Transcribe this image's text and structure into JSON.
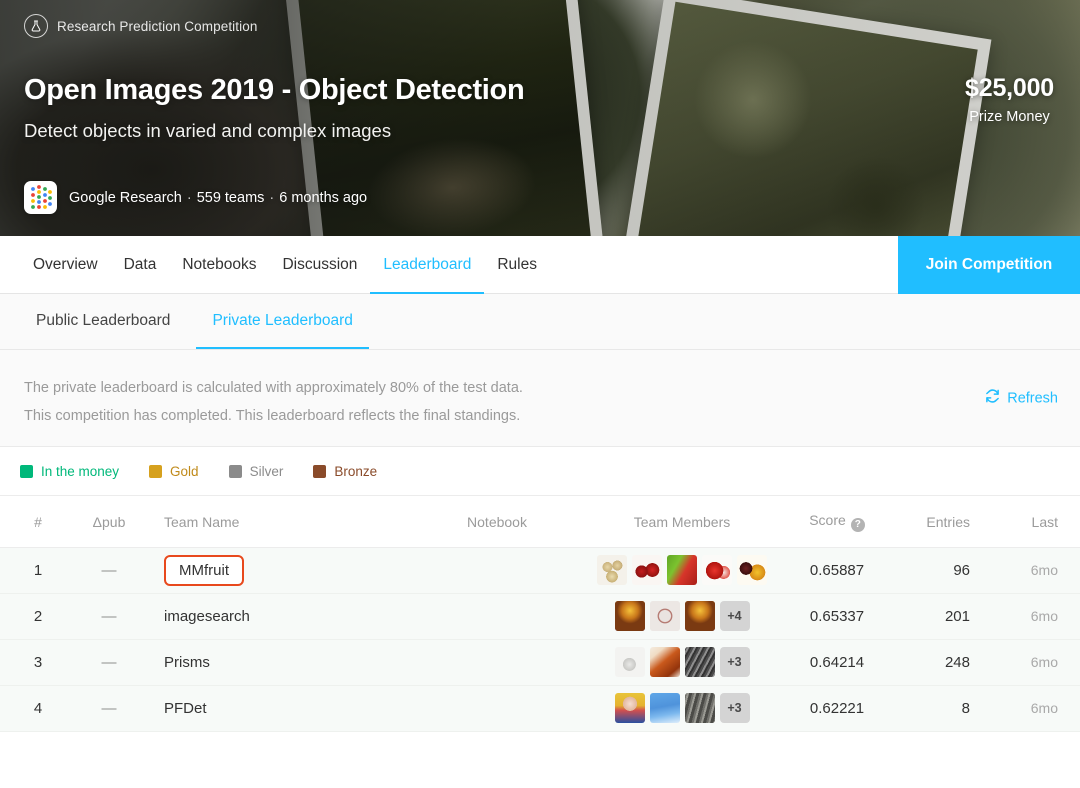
{
  "hero": {
    "badge_label": "Research Prediction Competition",
    "badge_icon": "flask-icon",
    "title": "Open Images 2019 - Object Detection",
    "subtitle": "Detect objects in varied and complex images",
    "prize_amount": "$25,000",
    "prize_label": "Prize Money",
    "org_name": "Google Research",
    "teams": "559 teams",
    "age": "6 months ago",
    "separator": "·"
  },
  "nav": {
    "tabs": [
      {
        "label": "Overview",
        "active": false
      },
      {
        "label": "Data",
        "active": false
      },
      {
        "label": "Notebooks",
        "active": false
      },
      {
        "label": "Discussion",
        "active": false
      },
      {
        "label": "Leaderboard",
        "active": true
      },
      {
        "label": "Rules",
        "active": false
      }
    ],
    "join_label": "Join Competition",
    "accent_color": "#20beff"
  },
  "subtabs": [
    {
      "label": "Public Leaderboard",
      "active": false
    },
    {
      "label": "Private Leaderboard",
      "active": true
    }
  ],
  "notice": {
    "line1": "The private leaderboard is calculated with approximately 80% of the test data.",
    "line2": "This competition has completed. This leaderboard reflects the final standings.",
    "refresh_label": "Refresh",
    "refresh_icon": "refresh-icon"
  },
  "legend": [
    {
      "label": "In the money",
      "color": "#00b87a",
      "text_color": "#00b87a"
    },
    {
      "label": "Gold",
      "color": "#d6a11e",
      "text_color": "#c08a1a"
    },
    {
      "label": "Silver",
      "color": "#8b8b8b",
      "text_color": "#8b8b8b"
    },
    {
      "label": "Bronze",
      "color": "#8a4b2a",
      "text_color": "#8a4b2a"
    }
  ],
  "table": {
    "headers": {
      "rank": "#",
      "delta": "Δpub",
      "team": "Team Name",
      "notebook": "Notebook",
      "members": "Team Members",
      "score": "Score",
      "score_help_icon": "question-mark-icon",
      "entries": "Entries",
      "last": "Last"
    },
    "rows": [
      {
        "rank": "1",
        "delta": "—",
        "team": "MMfruit",
        "highlighted": true,
        "score": "0.65887",
        "entries": "96",
        "last": "6mo",
        "in_the_money": true,
        "members": [
          {
            "avatar": "avatar-potatoes",
            "tier": "#4b6fa8",
            "dots": 3
          },
          {
            "avatar": "avatar-apples",
            "tier": "#d9d9d9",
            "dots": 1
          },
          {
            "avatar": "avatar-pepper",
            "tier": "#d9d9d9",
            "dots": 1
          },
          {
            "avatar": "avatar-strawberry",
            "tier": "#e8491d",
            "dots": 4
          },
          {
            "avatar": "avatar-mango",
            "tier": "#4b6fa8",
            "dots": 3
          }
        ],
        "more": null
      },
      {
        "rank": "2",
        "delta": "—",
        "team": "imagesearch",
        "highlighted": false,
        "score": "0.65337",
        "entries": "201",
        "last": "6mo",
        "in_the_money": true,
        "members": [
          {
            "avatar": "avatar-portrait-gold",
            "tier": "#00b87a",
            "dots": 1
          },
          {
            "avatar": "avatar-ring",
            "tier": "#00b87a",
            "dots": 1
          },
          {
            "avatar": "avatar-portrait-gold",
            "tier": "#00b87a",
            "dots": 1
          }
        ],
        "more": "+4"
      },
      {
        "rank": "3",
        "delta": "—",
        "team": "Prisms",
        "highlighted": false,
        "score": "0.64214",
        "entries": "248",
        "last": "6mo",
        "in_the_money": true,
        "members": [
          {
            "avatar": "avatar-hand",
            "tier": "#00b87a",
            "dots": 1
          },
          {
            "avatar": "avatar-fox",
            "tier": "#e8491d",
            "dots": 3
          },
          {
            "avatar": "avatar-grayscale",
            "tier": "#00b87a",
            "dots": 1
          }
        ],
        "more": "+3"
      },
      {
        "rank": "4",
        "delta": "—",
        "team": "PFDet",
        "highlighted": false,
        "score": "0.62221",
        "entries": "8",
        "last": "6mo",
        "in_the_money": true,
        "members": [
          {
            "avatar": "avatar-anime",
            "tier": "#d6a11e",
            "dots": 5
          },
          {
            "avatar": "avatar-blue-sky",
            "tier": "#e8491d",
            "dots": 4
          },
          {
            "avatar": "avatar-city",
            "tier": "#e8491d",
            "dots": 4
          }
        ],
        "more": "+3"
      }
    ]
  }
}
